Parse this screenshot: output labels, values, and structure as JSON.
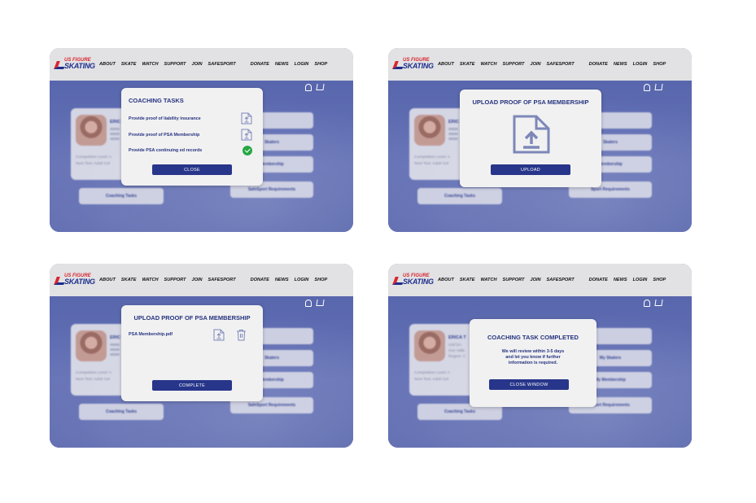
{
  "nav": {
    "logo_line1": "US FIGURE",
    "logo_line2": "SKATING",
    "items": [
      "ABOUT",
      "SKATE",
      "WATCH",
      "SUPPORT",
      "JOIN",
      "SAFESPORT",
      "DONATE",
      "NEWS",
      "LOGIN",
      "SHOP"
    ]
  },
  "background": {
    "profile_name_full": "ERICA T",
    "profile_name_short": "ERIC",
    "profile_line1": "USFSA",
    "profile_line2": "Sun Valle",
    "profile_line3": "Region: C",
    "competition_level": "Competition Level: A",
    "next_test": "Next Test: Adult Gol",
    "coaching_tasks": "Coaching Tasks",
    "skaters": "Skaters",
    "membership": "Membership",
    "my_skaters": "My Skaters",
    "my_membership": "My Membership",
    "safesport_req": "SafeSport Requirements",
    "sport_req": "Sport Requirements"
  },
  "screen1": {
    "title": "COACHING TASKS",
    "tasks": [
      "Provide proof of liability insurance",
      "Provide proof of PSA Membership",
      "Provide PSA continuing ed records"
    ],
    "close_label": "CLOSE"
  },
  "screen2": {
    "title": "UPLOAD PROOF OF PSA MEMBERSHIP",
    "upload_label": "UPLOAD"
  },
  "screen3": {
    "title": "UPLOAD PROOF OF PSA MEMBERSHIP",
    "filename": "PSA Membership.pdf",
    "complete_label": "COMPLETE"
  },
  "screen4": {
    "title": "COACHING TASK COMPLETED",
    "message_line1": "We will review within 3-5 days",
    "message_line2": "and let you know if further",
    "message_line3": "information is required.",
    "close_window_label": "CLOSE WINDOW"
  }
}
